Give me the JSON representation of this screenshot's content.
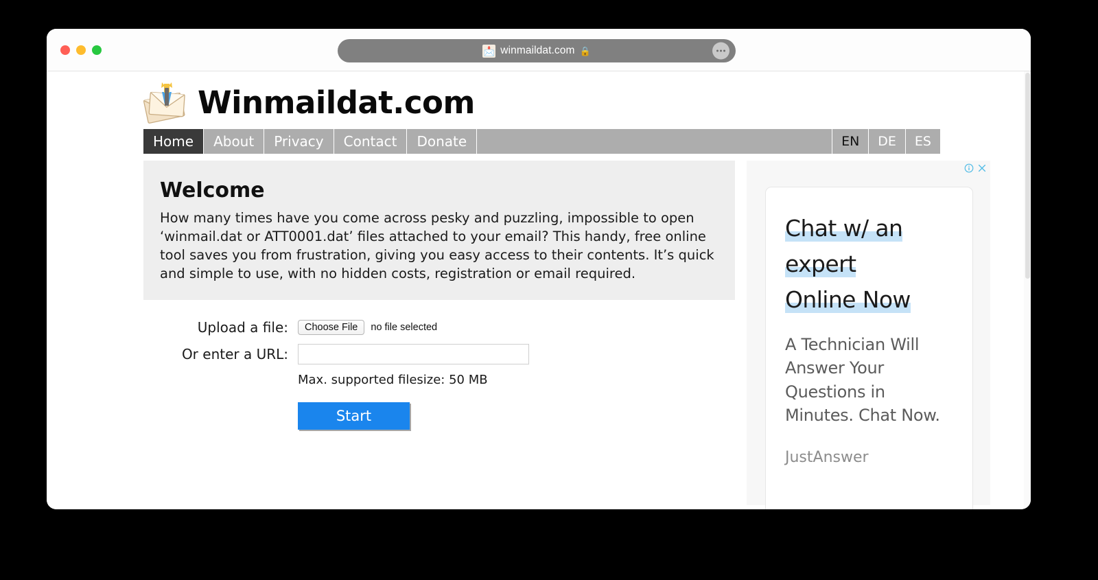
{
  "browser": {
    "traffic_lights": [
      {
        "name": "close",
        "color": "#ff5f56"
      },
      {
        "name": "minimize",
        "color": "#febc2e"
      },
      {
        "name": "maximize",
        "color": "#28c840"
      }
    ],
    "address": {
      "url_text": "winmaildat.com",
      "favicon": "📩",
      "lock_icon": "🔒",
      "menu_icon": "ellipsis-icon"
    }
  },
  "site": {
    "title": "Winmaildat.com",
    "logo_icon": "envelope-with-tool-icon"
  },
  "nav": {
    "items": [
      {
        "label": "Home",
        "active": true
      },
      {
        "label": "About",
        "active": false
      },
      {
        "label": "Privacy",
        "active": false
      },
      {
        "label": "Contact",
        "active": false
      },
      {
        "label": "Donate",
        "active": false
      }
    ],
    "languages": [
      {
        "label": "EN",
        "active": true
      },
      {
        "label": "DE",
        "active": false
      },
      {
        "label": "ES",
        "active": false
      }
    ],
    "background_color": "#adadad",
    "active_color": "#3a3a3a"
  },
  "welcome": {
    "heading": "Welcome",
    "body": "How many times have you come across pesky and puzzling, impossible to open ‘winmail.dat or ATT0001.dat’ files attached to your email? This handy, free online tool saves you from frustration, giving you easy access to their contents. It’s quick and simple to use, with no hidden costs, registration or email required.",
    "background_color": "#eeeeee"
  },
  "form": {
    "upload_label": "Upload a file:",
    "choose_file_label": "Choose File",
    "file_status": "no file selected",
    "url_label": "Or enter a URL:",
    "url_value": "",
    "url_placeholder": "",
    "filesize_note": "Max. supported filesize: 50 MB",
    "start_label": "Start",
    "start_color": "#1a85ed"
  },
  "ad": {
    "info_icon": "info-circle-icon",
    "close_icon": "close-x-icon",
    "icon_color": "#4fbbe6",
    "headline_lines": [
      "Chat w/ an",
      "expert",
      "Online Now"
    ],
    "highlight_color": "#c5e2f7",
    "body": "A Technician Will Answer Your Questions in Minutes. Chat Now.",
    "brand": "JustAnswer"
  }
}
